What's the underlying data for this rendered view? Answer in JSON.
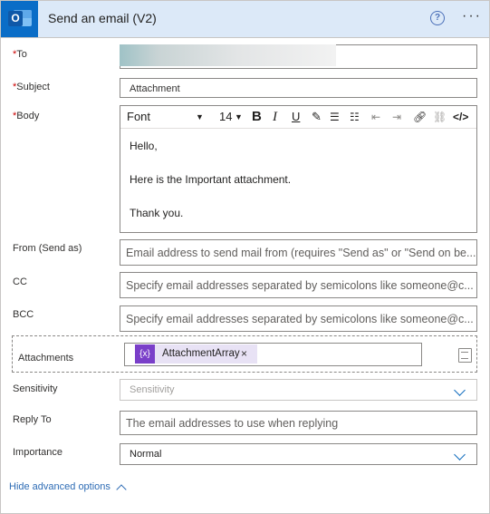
{
  "header": {
    "title": "Send an email (V2)",
    "help_icon": "question-circle-icon",
    "more_icon": "ellipsis-icon",
    "logo_icon": "outlook-icon"
  },
  "fields": {
    "to": {
      "label": "To",
      "required": true,
      "value": ""
    },
    "subject": {
      "label": "Subject",
      "required": true,
      "value": "Attachment"
    },
    "body": {
      "label": "Body",
      "required": true,
      "toolbar": {
        "font": "Font",
        "size": "14",
        "bold": "B",
        "italic": "I",
        "underline": "U"
      },
      "lines": [
        "Hello,",
        "Here is the Important attachment.",
        "Thank you."
      ]
    },
    "from": {
      "label": "From (Send as)",
      "placeholder": "Email address to send mail from (requires \"Send as\" or \"Send on be..."
    },
    "cc": {
      "label": "CC",
      "placeholder": "Specify email addresses separated by semicolons like someone@c..."
    },
    "bcc": {
      "label": "BCC",
      "placeholder": "Specify email addresses separated by semicolons like someone@c..."
    },
    "attachments": {
      "label": "Attachments",
      "token": "AttachmentArray",
      "token_icon": "{x}",
      "remove": "×"
    },
    "sensitivity": {
      "label": "Sensitivity",
      "placeholder": "Sensitivity"
    },
    "reply_to": {
      "label": "Reply To",
      "placeholder": "The email addresses to use when replying"
    },
    "importance": {
      "label": "Importance",
      "value": "Normal"
    }
  },
  "footer": {
    "advanced_label": "Hide advanced options"
  },
  "colors": {
    "header_bg": "#dce9f8",
    "accent": "#0f6cbd",
    "token": "#7a3fc9"
  }
}
